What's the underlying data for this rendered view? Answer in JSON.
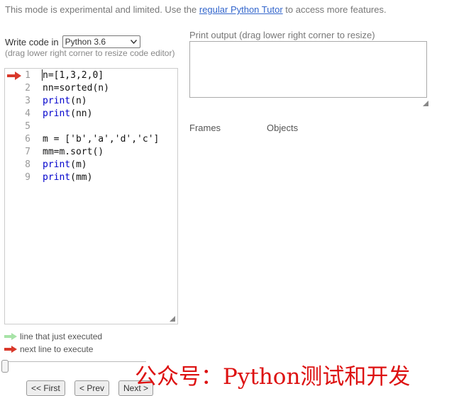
{
  "notice": {
    "prefix": "This mode is experimental and limited. Use the ",
    "link_text": "regular Python Tutor",
    "suffix": " to access more features."
  },
  "editor_panel": {
    "write_code_label": "Write code in",
    "language_selected": "Python 3.6",
    "resize_hint": "(drag lower right corner to resize code editor)",
    "lines": [
      {
        "num": "1",
        "tokens": [
          {
            "t": "n=[1,3,2,0]",
            "kw": false
          }
        ],
        "arrow": "red"
      },
      {
        "num": "2",
        "tokens": [
          {
            "t": "nn=sorted(n)",
            "kw": false
          }
        ],
        "arrow": ""
      },
      {
        "num": "3",
        "tokens": [
          {
            "t": "print",
            "kw": true
          },
          {
            "t": "(n)",
            "kw": false
          }
        ],
        "arrow": ""
      },
      {
        "num": "4",
        "tokens": [
          {
            "t": "print",
            "kw": true
          },
          {
            "t": "(nn)",
            "kw": false
          }
        ],
        "arrow": ""
      },
      {
        "num": "5",
        "tokens": [
          {
            "t": "",
            "kw": false
          }
        ],
        "arrow": ""
      },
      {
        "num": "6",
        "tokens": [
          {
            "t": "m = ['b','a','d','c']",
            "kw": false
          }
        ],
        "arrow": ""
      },
      {
        "num": "7",
        "tokens": [
          {
            "t": "mm=m.sort()",
            "kw": false
          }
        ],
        "arrow": ""
      },
      {
        "num": "8",
        "tokens": [
          {
            "t": "print",
            "kw": true
          },
          {
            "t": "(m)",
            "kw": false
          }
        ],
        "arrow": ""
      },
      {
        "num": "9",
        "tokens": [
          {
            "t": "print",
            "kw": true
          },
          {
            "t": "(mm)",
            "kw": false
          }
        ],
        "arrow": ""
      }
    ]
  },
  "legend": {
    "just_executed": "line that just executed",
    "next_line": "next line to execute"
  },
  "navigation": {
    "first": "<< First",
    "prev": "< Prev",
    "next": "Next >"
  },
  "output_panel": {
    "print_output_label": "Print output (drag lower right corner to resize)",
    "print_output_value": "",
    "frames_label": "Frames",
    "objects_label": "Objects"
  },
  "watermark": {
    "text": "公众号：Python测试和开发"
  },
  "colors": {
    "red_arrow": "#d9382a",
    "green_arrow": "#a7e3a7",
    "keyword": "#0000cc",
    "link": "#3366cc",
    "watermark": "#dd1111"
  },
  "icons": {
    "current_line_marker": "red-arrow-icon",
    "language_dropdown": "chevron-down-icon",
    "resize_grip": "resize-grip-icon"
  }
}
